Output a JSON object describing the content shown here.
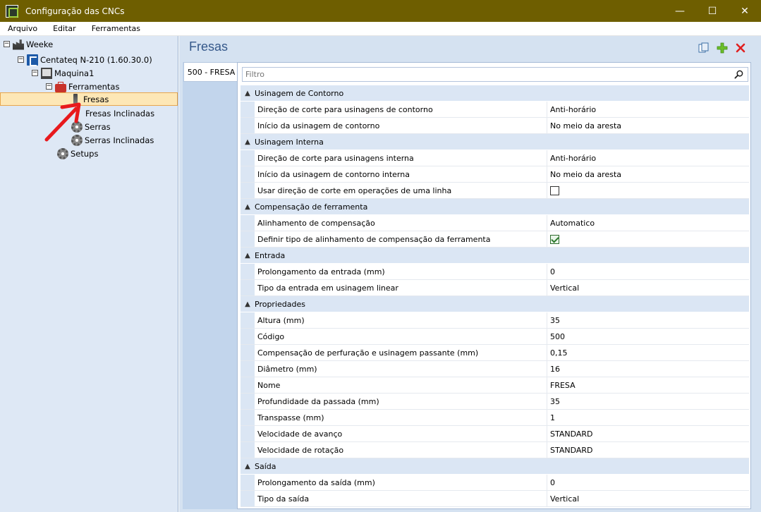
{
  "window": {
    "title": "Configuração das CNCs",
    "minimize": "—",
    "maximize": "☐",
    "close": "✕"
  },
  "menu": [
    "Arquivo",
    "Editar",
    "Ferramentas"
  ],
  "tree": {
    "root": "Weeke",
    "cnc": "Centateq N-210 (1.60.30.0)",
    "machine": "Maquina1",
    "tools": "Ferramentas",
    "items": [
      "Fresas",
      "Fresas Inclinadas",
      "Serras",
      "Serras Inclinadas"
    ],
    "setups": "Setups"
  },
  "panel": {
    "title": "Fresas"
  },
  "tab": {
    "label": "500 - FRESA"
  },
  "filter": {
    "placeholder": "Filtro"
  },
  "categories": [
    {
      "name": "Usinagem de Contorno",
      "props": [
        {
          "name": "Direção de corte para usinagens de contorno",
          "value": "Anti-horário"
        },
        {
          "name": "Início da usinagem de contorno",
          "value": "No meio da aresta"
        }
      ]
    },
    {
      "name": "Usinagem Interna",
      "props": [
        {
          "name": "Direção de corte para usinagens interna",
          "value": "Anti-horário"
        },
        {
          "name": "Início da usinagem de contorno interna",
          "value": "No meio da aresta"
        },
        {
          "name": "Usar direção de corte em operações de uma linha",
          "checked": false
        }
      ]
    },
    {
      "name": "Compensação de ferramenta",
      "props": [
        {
          "name": "Alinhamento de compensação",
          "value": "Automatico"
        },
        {
          "name": "Definir tipo de alinhamento de compensação da ferramenta",
          "checked": true
        }
      ]
    },
    {
      "name": "Entrada",
      "props": [
        {
          "name": "Prolongamento da entrada (mm)",
          "value": "0"
        },
        {
          "name": "Tipo da entrada em usinagem linear",
          "value": "Vertical"
        }
      ]
    },
    {
      "name": "Propriedades",
      "props": [
        {
          "name": "Altura (mm)",
          "value": "35"
        },
        {
          "name": "Código",
          "value": "500"
        },
        {
          "name": "Compensação de perfuração e usinagem passante (mm)",
          "value": "0,15"
        },
        {
          "name": "Diâmetro (mm)",
          "value": "16"
        },
        {
          "name": "Nome",
          "value": "FRESA"
        },
        {
          "name": "Profundidade da passada (mm)",
          "value": "35"
        },
        {
          "name": "Transpasse (mm)",
          "value": "1"
        },
        {
          "name": "Velocidade de avanço",
          "value": "STANDARD"
        },
        {
          "name": "Velocidade de rotação",
          "value": "STANDARD"
        }
      ]
    },
    {
      "name": "Saída",
      "props": [
        {
          "name": "Prolongamento da saída (mm)",
          "value": "0"
        },
        {
          "name": "Tipo da saída",
          "value": "Vertical"
        }
      ]
    }
  ],
  "colors": {
    "titlebar": "#6e5e00",
    "tree_bg": "#dee8f5",
    "selection": "#fde7b6",
    "accent": "#35588a",
    "annotation": "#e8191d"
  }
}
